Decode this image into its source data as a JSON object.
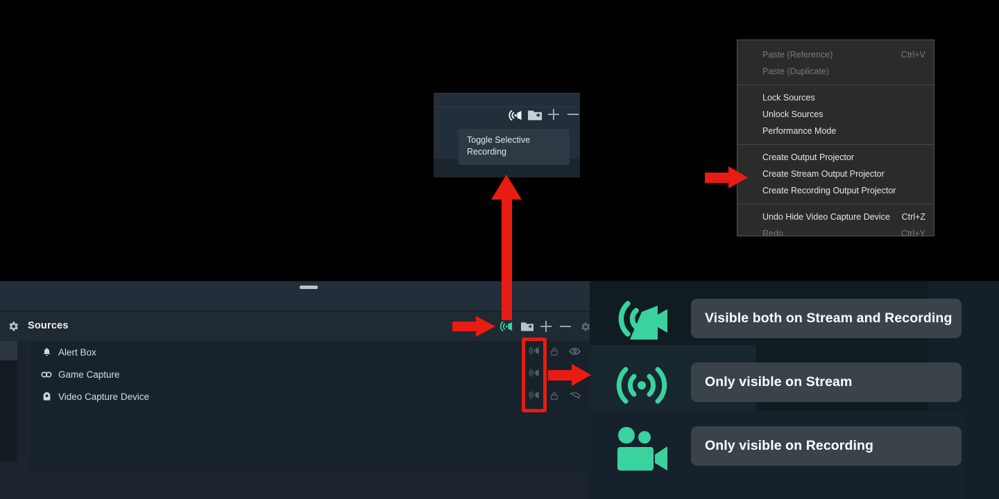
{
  "colors": {
    "accent_teal": "#3ad29f",
    "arrow_red": "#e81c12",
    "panel_dark": "#18222a",
    "header_bar": "#1f2a33",
    "menu_bg": "#2b2b2b",
    "legend_box": "#3b434a"
  },
  "context_menu": {
    "name": "sources-context-menu",
    "groups": [
      {
        "items": [
          {
            "label": "Paste (Reference)",
            "shortcut": "Ctrl+V",
            "disabled": true
          },
          {
            "label": "Paste (Duplicate)",
            "shortcut": "",
            "disabled": true
          }
        ]
      },
      {
        "items": [
          {
            "label": "Lock Sources",
            "shortcut": "",
            "disabled": false
          },
          {
            "label": "Unlock Sources",
            "shortcut": "",
            "disabled": false
          },
          {
            "label": "Performance Mode",
            "shortcut": "",
            "disabled": false
          }
        ]
      },
      {
        "items": [
          {
            "label": "Create Output Projector",
            "shortcut": "",
            "disabled": false
          },
          {
            "label": "Create Stream Output Projector",
            "shortcut": "",
            "disabled": false
          },
          {
            "label": "Create Recording Output Projector",
            "shortcut": "",
            "disabled": false
          }
        ]
      },
      {
        "items": [
          {
            "label": "Undo Hide Video Capture Device",
            "shortcut": "Ctrl+Z",
            "disabled": false
          },
          {
            "label": "Redo",
            "shortcut": "Ctrl+Y",
            "disabled": true
          }
        ]
      }
    ]
  },
  "tooltip": {
    "line1": "Toggle Selective",
    "line2": "Recording"
  },
  "inset_toolbar": {
    "icons": [
      {
        "name": "selective-recording-icon"
      },
      {
        "name": "add-scene-folder-icon"
      },
      {
        "name": "plus-icon"
      },
      {
        "name": "minus-icon"
      }
    ]
  },
  "sources_panel": {
    "title": "Sources",
    "gear_icon": "gear-icon",
    "toolbar": [
      {
        "name": "selective-recording-toggle"
      },
      {
        "name": "add-source-folder-icon"
      },
      {
        "name": "add-source-icon"
      },
      {
        "name": "remove-source-icon"
      },
      {
        "name": "source-properties-gear-icon"
      }
    ],
    "items": [
      {
        "label": "Alert Box",
        "icon": "bell-icon"
      },
      {
        "label": "Game Capture",
        "icon": "link-icon"
      },
      {
        "label": "Video Capture Device",
        "icon": "webcam-icon"
      }
    ]
  },
  "legend": {
    "rows": [
      {
        "icon": "stream-and-recording-icon",
        "label": "Visible both on Stream and Recording"
      },
      {
        "icon": "stream-only-icon",
        "label": "Only visible on Stream"
      },
      {
        "icon": "recording-only-icon",
        "label": "Only visible on Recording"
      }
    ]
  },
  "annotations": {
    "arrow_menu": "arrow-pointing-to-create-stream-output-projector",
    "arrow_toolbar": "arrow-pointing-to-selective-recording-toggle",
    "arrow_legend": "arrow-pointing-to-legend",
    "arrow_up": "arrow-pointing-up-to-tooltip",
    "highlight_rect": "highlight-selective-recording-column"
  }
}
